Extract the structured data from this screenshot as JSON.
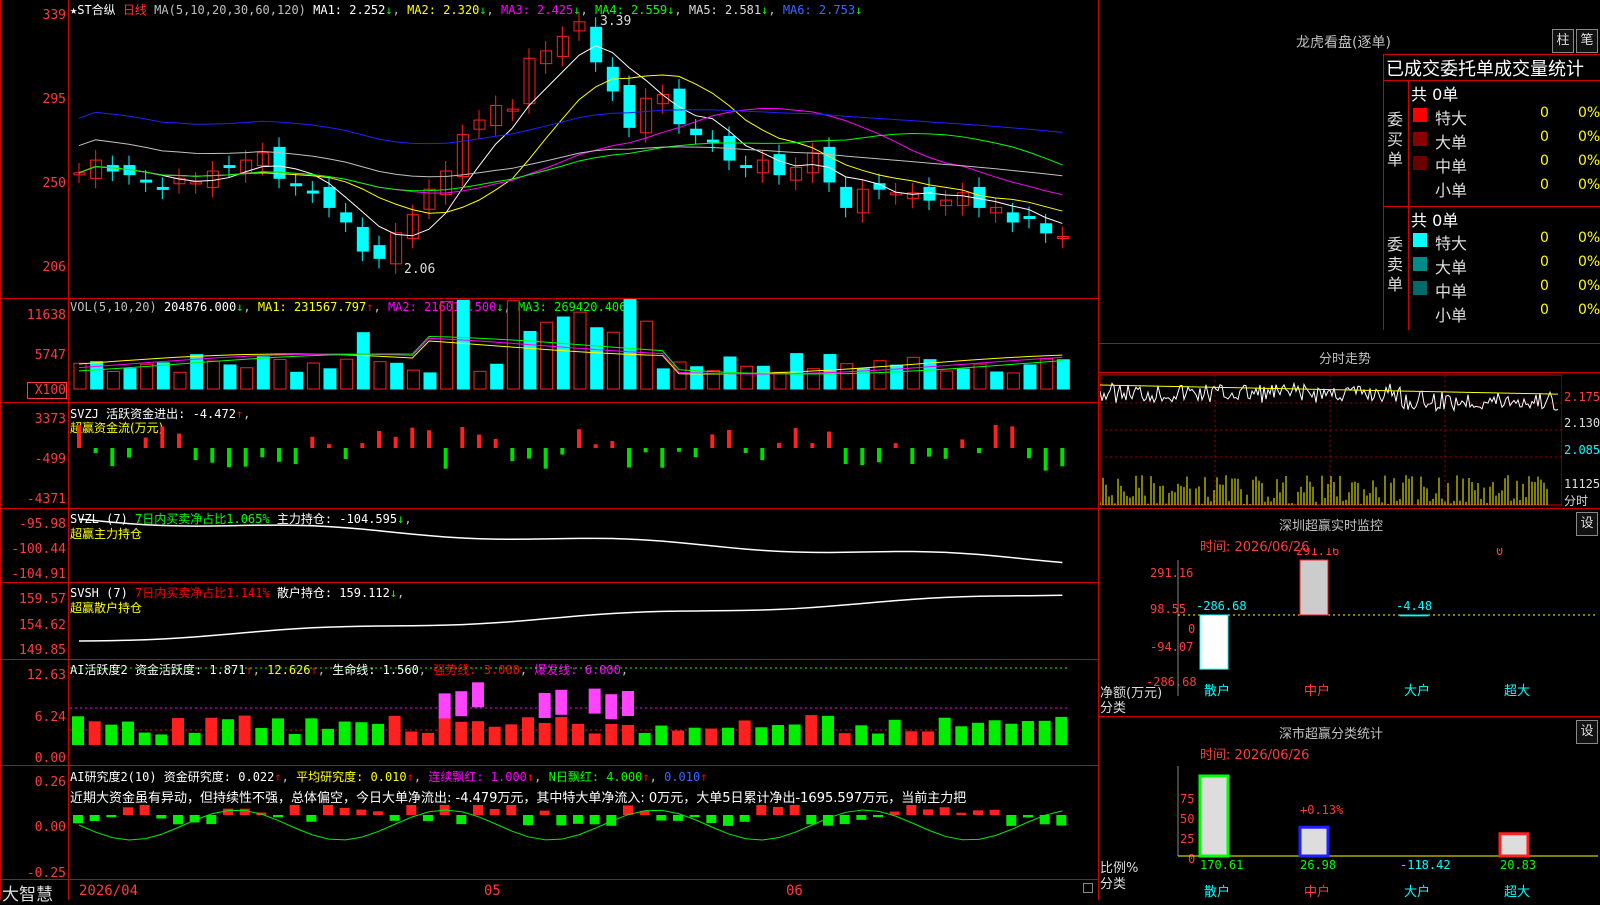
{
  "colors": {
    "up": "#ff2020",
    "down": "#00ffff",
    "grid": "#d00000",
    "ma1": "#ffffff",
    "ma2": "#ffff00",
    "ma3": "#ff00ff",
    "ma4": "#00ff00",
    "ma5": "#c0c0c0",
    "ma6": "#2020ff"
  },
  "header": {
    "stock": "★ST合纵",
    "period": "日线",
    "ma_label": "MA(5,10,20,30,60,120)",
    "ma1": "MA1: 2.252",
    "ma2": "MA2: 2.320",
    "ma3": "MA3: 2.425",
    "ma4": "MA4: 2.559",
    "ma5": "MA5: 2.581",
    "ma6": "MA6: 2.753",
    "high_mark": "3.39",
    "low_mark": "2.06"
  },
  "price_axis": [
    "339",
    "295",
    "250",
    "206"
  ],
  "vol": {
    "title": "VOL(5,10,20)",
    "value": "204876.000",
    "ma1": "MA1: 231567.797",
    "ma2": "MA2: 216014.500",
    "ma3": "MA3: 269420.406",
    "axis": [
      "11638",
      "5747",
      "X100"
    ]
  },
  "svzj": {
    "title": "SVZJ  活跃资金进出: -4.472",
    "subtitle": "超赢资金流(万元)",
    "axis": [
      "3373",
      "-499",
      "-4371"
    ]
  },
  "svzl": {
    "title": "SVZL (7)",
    "t2": "7日内买卖净占比1.065%",
    "t3": "主力持仓: -104.595",
    "subtitle": "超赢主力持仓",
    "axis": [
      "-95.98",
      "-100.44",
      "-104.91"
    ]
  },
  "svsh": {
    "title": "SVSH (7)",
    "t2": "7日内买卖净占比1.141%",
    "t3": "散户持仓: 159.112",
    "subtitle": "超赢散户持仓",
    "axis": [
      "159.57",
      "154.62",
      "149.85"
    ]
  },
  "ai1": {
    "t1": "AI活跃度2 资金活跃度: 1.871",
    "t2": "12.626",
    "t3": "生命线: 1.560",
    "t4": "强势线: 3.000",
    "t5": "爆发线: 6.000",
    "axis": [
      "12.63",
      "6.24",
      "0.00"
    ]
  },
  "ai2": {
    "t1": "AI研究度2(10) 资金研究度: 0.022",
    "t2": "平均研究度: 0.010",
    "t3": "连续飘红: 1.000",
    "t4": "N日飘红: 4.000",
    "t5": "0.010",
    "axis": [
      "0.26",
      "0.00",
      "-0.25"
    ],
    "comment": "近期大资金虽有异动，但持续性不强，总体偏空，今日大单净流出: -4.479万元，其中特大单净流入: 0万元，大单5日累计净出-1695.597万元，当前主力把"
  },
  "bottom_axis": {
    "brand": "大智慧",
    "d1": "2026/04",
    "d2": "05",
    "d3": "06"
  },
  "dragon": {
    "title": "龙虎看盘(逐单)",
    "btn1": "柱",
    "btn2": "笔",
    "subtitle": "已成交委托单成交量统计",
    "buy_label": "委买单",
    "sell_label": "委卖单",
    "buy_total": "共 0单",
    "sell_total": "共 0单",
    "buy_rows": [
      {
        "name": "特大",
        "count": "0",
        "pct": "0%"
      },
      {
        "name": "大单",
        "count": "0",
        "pct": "0%"
      },
      {
        "name": "中单",
        "count": "0",
        "pct": "0%"
      },
      {
        "name": "小单",
        "count": "0",
        "pct": "0%"
      }
    ],
    "sell_rows": [
      {
        "name": "特大",
        "count": "0",
        "pct": "0%"
      },
      {
        "name": "大单",
        "count": "0",
        "pct": "0%"
      },
      {
        "name": "中单",
        "count": "0",
        "pct": "0%"
      },
      {
        "name": "小单",
        "count": "0",
        "pct": "0%"
      }
    ],
    "buy_colors": [
      "#ff0000",
      "#8b0000",
      "#6b0000",
      ""
    ],
    "sell_colors": [
      "#00ffff",
      "#008b8b",
      "#006b6b",
      ""
    ]
  },
  "intraday": {
    "title": "分时走势",
    "p1": "2.175",
    "p2": "2.130",
    "p3": "2.085",
    "v1": "11125",
    "v2": "分时"
  },
  "monitor": {
    "title": "深圳超赢实时监控",
    "btn": "设",
    "time": "时间: 2026/06/26",
    "axis": [
      "291.16",
      "98.55",
      "0",
      "-94.07",
      "-286.68"
    ],
    "ylabel": "净额(万元)",
    "xlabel": "分类",
    "cats": [
      "散户",
      "中户",
      "大户",
      "超大"
    ],
    "values": [
      "-286.68",
      "291.16",
      "-4.48",
      "0"
    ]
  },
  "classify": {
    "title": "深市超赢分类统计",
    "btn": "设",
    "time": "时间: 2026/06/26",
    "axis": [
      "75",
      "50",
      "25",
      "0"
    ],
    "ylabel": "比例%",
    "xlabel": "分类",
    "cats": [
      "散户",
      "中户",
      "大户",
      "超大"
    ],
    "values": [
      "170.61",
      "26.98",
      "-118.42",
      "20.83"
    ],
    "pct_label": "+0.13%"
  }
}
